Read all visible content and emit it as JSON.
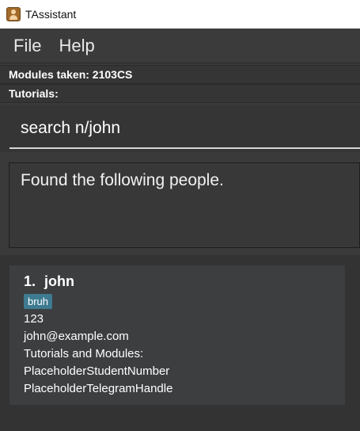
{
  "window": {
    "title": "TAssistant",
    "icon": "address-book-icon"
  },
  "menu": {
    "items": [
      {
        "label": "File"
      },
      {
        "label": "Help"
      }
    ]
  },
  "status": {
    "modules_taken": "Modules taken: 2103CS",
    "tutorials": "Tutorials:"
  },
  "command": {
    "value": "search n/john"
  },
  "result": {
    "message": "Found the following people."
  },
  "people": [
    {
      "index": "1.",
      "name": "john",
      "tags": [
        "bruh"
      ],
      "phone": "123",
      "email": "john@example.com",
      "tutorials_modules": "Tutorials and Modules:",
      "student_number": "PlaceholderStudentNumber",
      "telegram_handle": "PlaceholderTelegramHandle"
    }
  ],
  "colors": {
    "tag_background": "#3e7b91",
    "background": "#3a3a3a",
    "card": "#3d3e40"
  }
}
